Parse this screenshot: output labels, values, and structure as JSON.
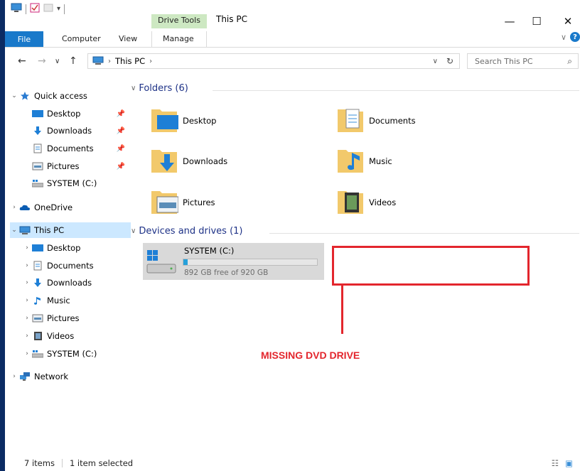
{
  "window": {
    "context_tab": "Drive Tools",
    "title": "This PC",
    "controls": {
      "minimize": "—",
      "maximize": "☐",
      "close": "✕"
    }
  },
  "ribbon": {
    "tabs": [
      "File",
      "Computer",
      "View",
      "Manage"
    ],
    "help": "?"
  },
  "address": {
    "path": [
      "This PC"
    ],
    "search_placeholder": "Search This PC"
  },
  "sidebar": {
    "quick_access": "Quick access",
    "quick_items": [
      "Desktop",
      "Downloads",
      "Documents",
      "Pictures",
      "SYSTEM (C:)"
    ],
    "onedrive": "OneDrive",
    "this_pc": "This PC",
    "this_pc_items": [
      "Desktop",
      "Documents",
      "Downloads",
      "Music",
      "Pictures",
      "Videos",
      "SYSTEM (C:)"
    ],
    "network": "Network"
  },
  "content": {
    "folders_header": "Folders (6)",
    "folders": [
      "Desktop",
      "Documents",
      "Downloads",
      "Music",
      "Pictures",
      "Videos"
    ],
    "devices_header": "Devices and drives (1)",
    "drive": {
      "name": "SYSTEM (C:)",
      "free_text": "892 GB free of 920 GB",
      "used_fraction": 0.03
    }
  },
  "annotation": {
    "text": "MISSING DVD DRIVE",
    "color": "#e3262d"
  },
  "status": {
    "items": "7 items",
    "selected": "1 item selected"
  },
  "colors": {
    "accent": "#1979ca",
    "selection": "#cce8ff",
    "context_tab": "#cde8c2",
    "header_text": "#1e3287"
  }
}
